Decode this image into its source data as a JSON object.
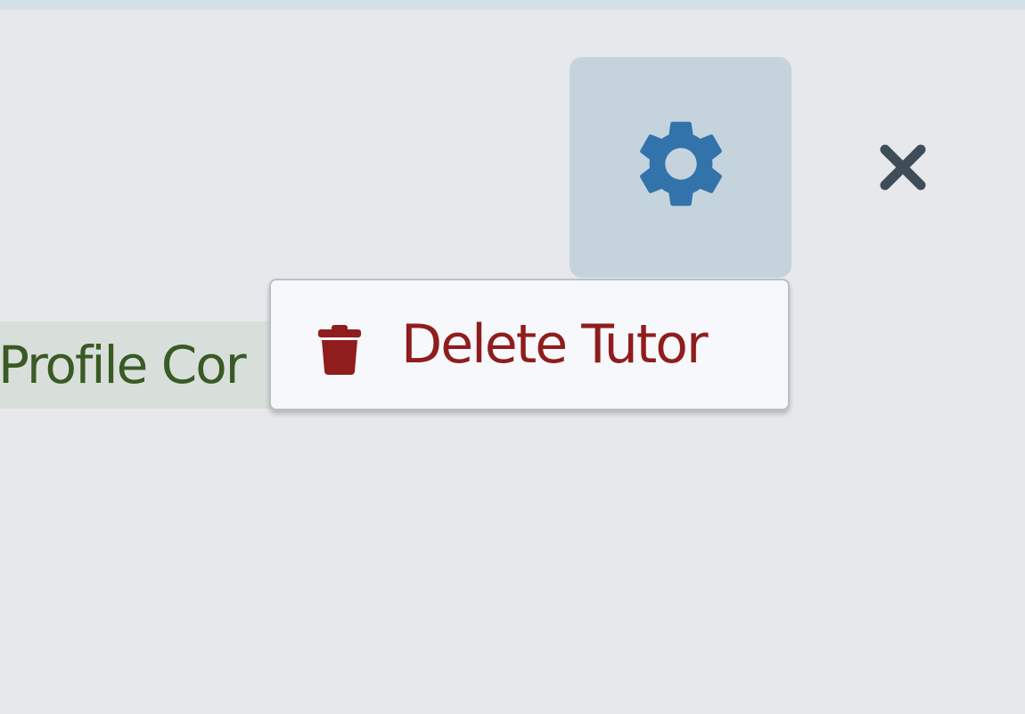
{
  "header": {
    "settings_icon": "gear-icon",
    "close_icon": "close-icon"
  },
  "status_badge": {
    "text": "Profile Cor"
  },
  "menu": {
    "items": [
      {
        "label": "Delete Tutor",
        "icon": "trash-icon"
      }
    ]
  },
  "colors": {
    "background": "#e6e8ec",
    "top_strip": "#d3e0e6",
    "settings_active_bg": "#c5d3dd",
    "gear": "#3373ab",
    "close": "#3f4d58",
    "danger": "#8f1d1d",
    "status_text": "#3a5a25",
    "status_bg": "#d8dfda",
    "menu_bg": "#f7f8fb"
  }
}
